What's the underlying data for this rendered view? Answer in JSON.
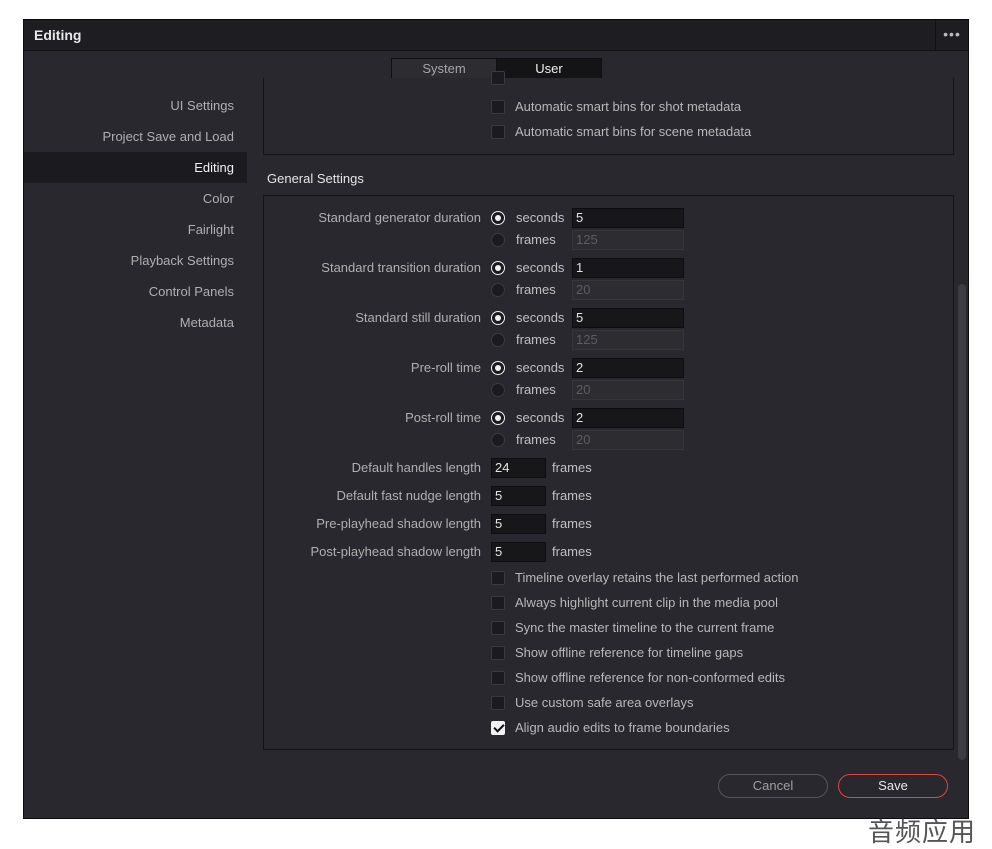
{
  "window": {
    "title": "Editing"
  },
  "tabs": [
    {
      "label": "System",
      "active": false
    },
    {
      "label": "User",
      "active": true
    }
  ],
  "sidebar": {
    "items": [
      {
        "label": "UI Settings",
        "active": false
      },
      {
        "label": "Project Save and Load",
        "active": false
      },
      {
        "label": "Editing",
        "active": true
      },
      {
        "label": "Color",
        "active": false
      },
      {
        "label": "Fairlight",
        "active": false
      },
      {
        "label": "Playback Settings",
        "active": false
      },
      {
        "label": "Control Panels",
        "active": false
      },
      {
        "label": "Metadata",
        "active": false
      }
    ]
  },
  "smart_bins": {
    "options": [
      {
        "label": "Automatic smart bins for shot metadata",
        "checked": false
      },
      {
        "label": "Automatic smart bins for scene metadata",
        "checked": false
      }
    ]
  },
  "general": {
    "title": "General Settings",
    "durations": [
      {
        "label": "Standard generator duration",
        "unit_selected": "seconds",
        "seconds_label": "seconds",
        "frames_label": "frames",
        "seconds": "5",
        "frames": "125"
      },
      {
        "label": "Standard transition duration",
        "unit_selected": "seconds",
        "seconds_label": "seconds",
        "frames_label": "frames",
        "seconds": "1",
        "frames": "20"
      },
      {
        "label": "Standard still duration",
        "unit_selected": "seconds",
        "seconds_label": "seconds",
        "frames_label": "frames",
        "seconds": "5",
        "frames": "125"
      },
      {
        "label": "Pre-roll time",
        "unit_selected": "seconds",
        "seconds_label": "seconds",
        "frames_label": "frames",
        "seconds": "2",
        "frames": "20"
      },
      {
        "label": "Post-roll time",
        "unit_selected": "seconds",
        "seconds_label": "seconds",
        "frames_label": "frames",
        "seconds": "2",
        "frames": "20"
      }
    ],
    "lengths": [
      {
        "label": "Default handles length",
        "value": "24",
        "unit": "frames"
      },
      {
        "label": "Default fast nudge length",
        "value": "5",
        "unit": "frames"
      },
      {
        "label": "Pre-playhead shadow length",
        "value": "5",
        "unit": "frames"
      },
      {
        "label": "Post-playhead shadow length",
        "value": "5",
        "unit": "frames"
      }
    ],
    "options": [
      {
        "label": "Timeline overlay retains the last performed action",
        "checked": false
      },
      {
        "label": "Always highlight current clip in the media pool",
        "checked": false
      },
      {
        "label": "Sync the master timeline to the current frame",
        "checked": false
      },
      {
        "label": "Show offline reference for timeline gaps",
        "checked": false
      },
      {
        "label": "Show offline reference for non-conformed edits",
        "checked": false
      },
      {
        "label": "Use custom safe area overlays",
        "checked": false
      },
      {
        "label": "Align audio edits to frame boundaries",
        "checked": true
      }
    ]
  },
  "buttons": {
    "cancel": "Cancel",
    "save": "Save"
  },
  "colors": {
    "accent_save_border": "#e0463a",
    "window_bg": "#28282e",
    "titlebar_bg": "#1e1e22"
  },
  "watermark": "音频应用"
}
